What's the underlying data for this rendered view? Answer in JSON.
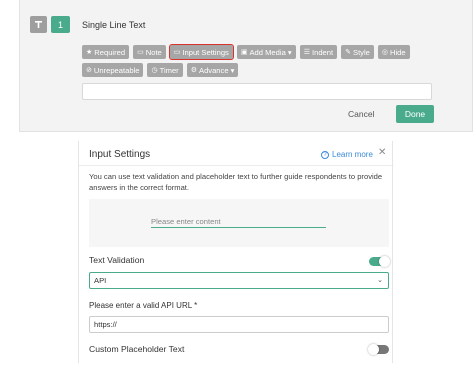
{
  "editor": {
    "type_icon": "text-format-icon",
    "question_number": "1",
    "question_title": "Single Line Text",
    "chips_row1": [
      {
        "icon": "★",
        "label": "Required"
      },
      {
        "icon": "▭",
        "label": "Note"
      },
      {
        "icon": "▭",
        "label": "Input Settings"
      },
      {
        "icon": "▣",
        "label": "Add Media ▾"
      },
      {
        "icon": "☰",
        "label": "Indent"
      },
      {
        "icon": "✎",
        "label": "Style"
      },
      {
        "icon": "◎",
        "label": "Hide"
      }
    ],
    "chips_row2": [
      {
        "icon": "⊘",
        "label": "Unrepeatable"
      },
      {
        "icon": "◷",
        "label": "Timer"
      },
      {
        "icon": "⚙",
        "label": "Advance ▾"
      }
    ],
    "cancel_label": "Cancel",
    "done_label": "Done"
  },
  "panel": {
    "title": "Input Settings",
    "learn_more": "Learn more",
    "close_glyph": "✕",
    "description": "You can use text validation and placeholder text to further guide respondents to provide answers in the correct format.",
    "preview_placeholder": "Please enter content",
    "text_validation_label": "Text Validation",
    "text_validation_enabled": true,
    "validation_selected": "API",
    "api_url_label": "Please enter a valid API URL *",
    "api_url_value": "https://",
    "custom_placeholder_label": "Custom Placeholder Text",
    "custom_placeholder_enabled": false
  },
  "colors": {
    "accent_green": "#4aab8c",
    "chip_gray": "#a6a6a6",
    "highlight_red": "#d9342b",
    "link_blue": "#3b8ad9"
  }
}
